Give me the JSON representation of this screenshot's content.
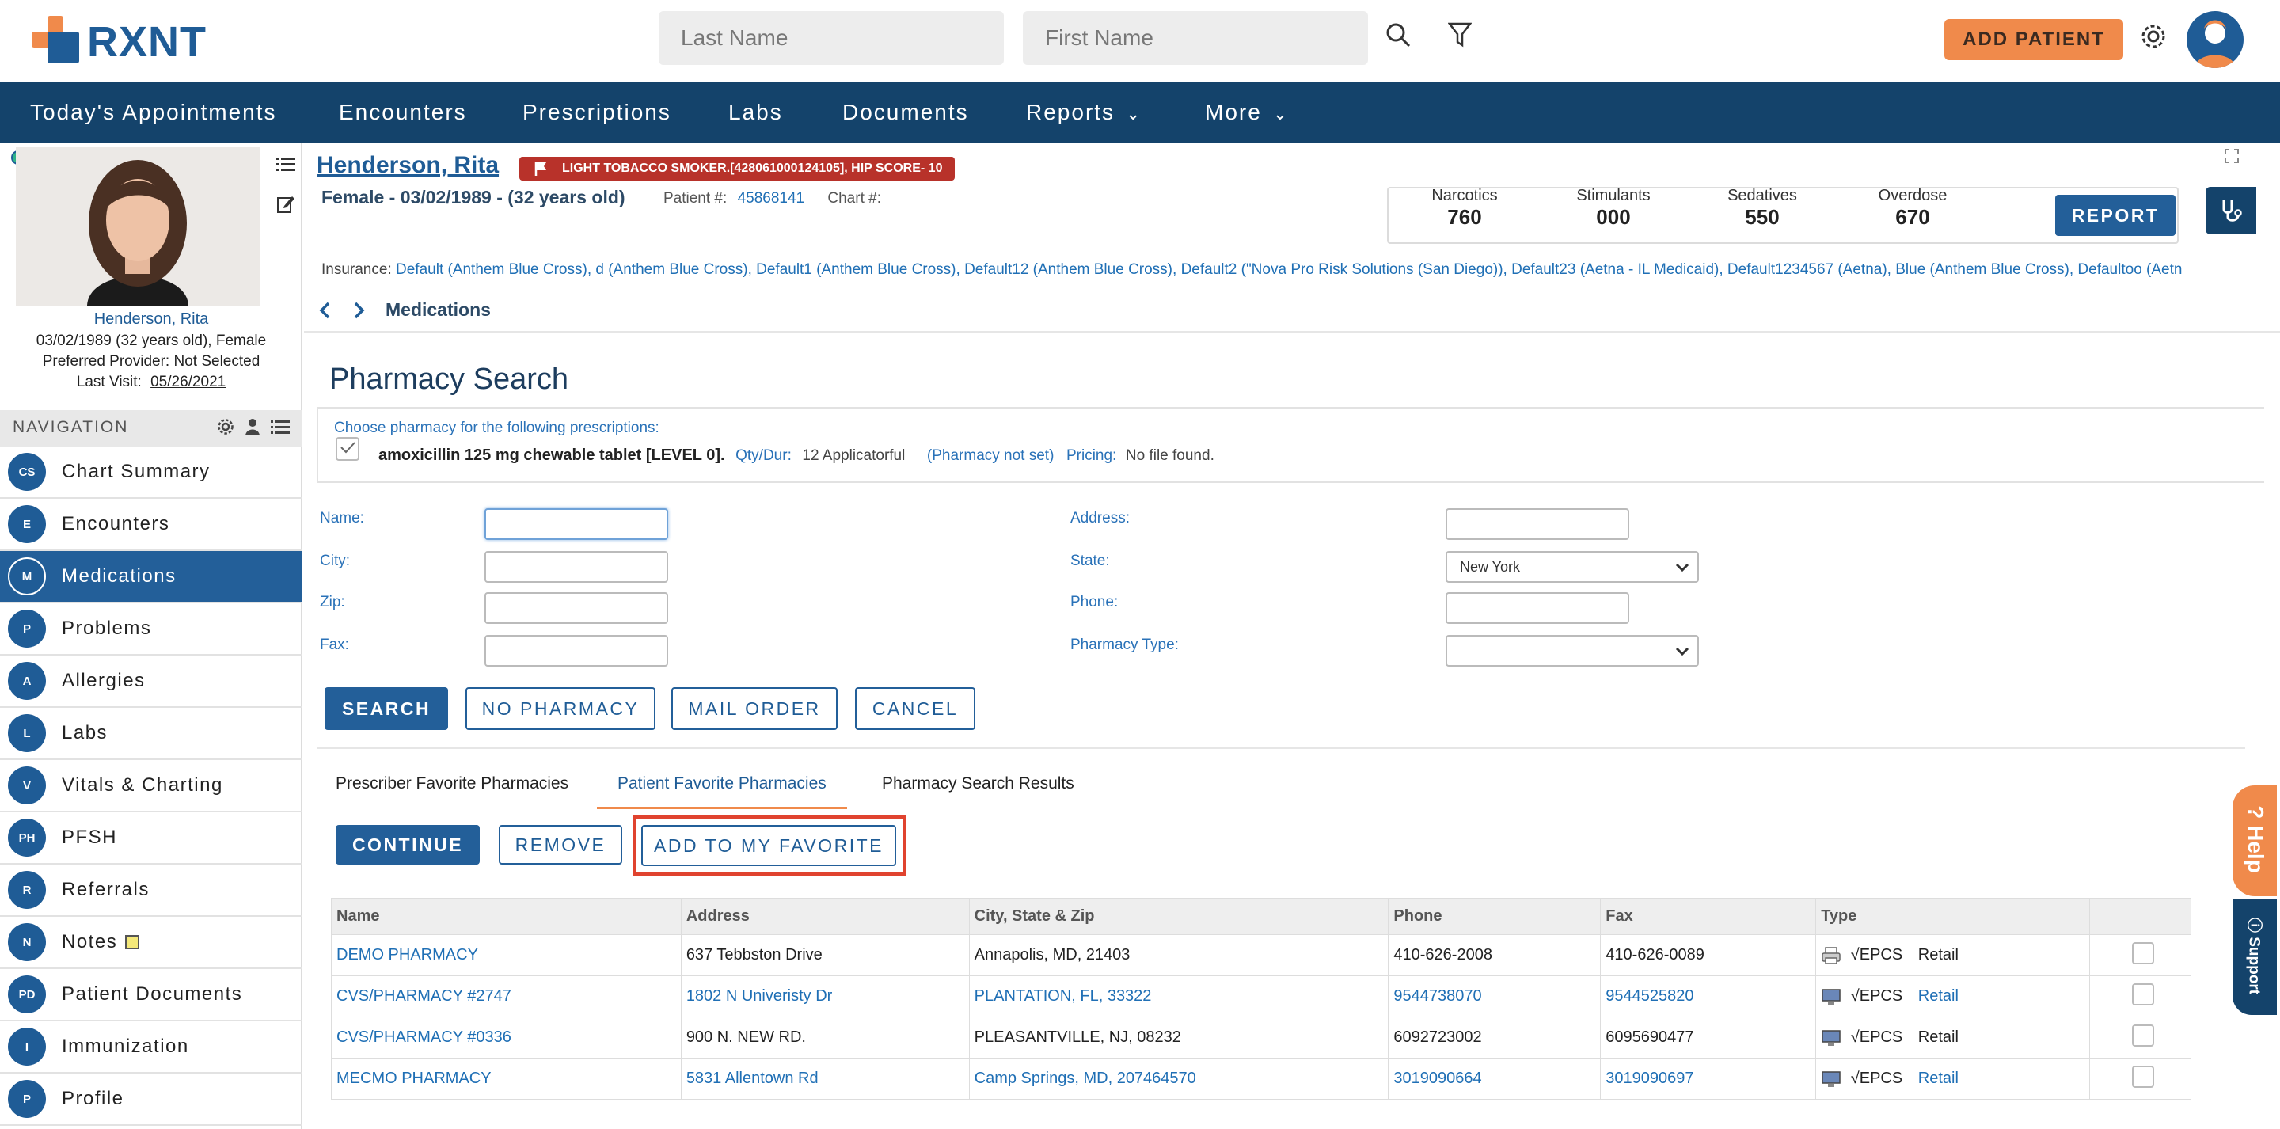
{
  "app": {
    "logo_text": "RXNT",
    "search": {
      "last_name_placeholder": "Last Name",
      "first_name_placeholder": "First Name"
    },
    "add_patient_label": "ADD PATIENT"
  },
  "nav": {
    "items": [
      {
        "label": "Today's Appointments"
      },
      {
        "label": "Encounters"
      },
      {
        "label": "Prescriptions"
      },
      {
        "label": "Labs"
      },
      {
        "label": "Documents"
      },
      {
        "label": "Reports"
      },
      {
        "label": "More"
      }
    ]
  },
  "patient_card": {
    "name": "Henderson, Rita",
    "dob_line": "03/02/1989 (32 years old), Female",
    "provider_line": "Preferred Provider: Not Selected",
    "last_visit_label": "Last Visit:",
    "last_visit_date": "05/26/2021"
  },
  "sidebar": {
    "nav_title": "NAVIGATION",
    "items": [
      {
        "badge": "CS",
        "label": "Chart Summary"
      },
      {
        "badge": "E",
        "label": "Encounters"
      },
      {
        "badge": "M",
        "label": "Medications"
      },
      {
        "badge": "P",
        "label": "Problems"
      },
      {
        "badge": "A",
        "label": "Allergies"
      },
      {
        "badge": "L",
        "label": "Labs"
      },
      {
        "badge": "V",
        "label": "Vitals & Charting"
      },
      {
        "badge": "PH",
        "label": "PFSH"
      },
      {
        "badge": "R",
        "label": "Referrals"
      },
      {
        "badge": "N",
        "label": "Notes"
      },
      {
        "badge": "PD",
        "label": "Patient Documents"
      },
      {
        "badge": "I",
        "label": "Immunization"
      },
      {
        "badge": "P",
        "label": "Profile"
      }
    ]
  },
  "header": {
    "patient_name": "Henderson, Rita",
    "flag_text": "LIGHT TOBACCO SMOKER.[428061000124105], HIP SCORE- 10",
    "demographics": "Female - 03/02/1989 - (32 years old)",
    "patient_num_label": "Patient #:",
    "patient_num": "45868141",
    "chart_label": "Chart #:",
    "scores": [
      {
        "label": "Narcotics",
        "value": "760"
      },
      {
        "label": "Stimulants",
        "value": "000"
      },
      {
        "label": "Sedatives",
        "value": "550"
      },
      {
        "label": "Overdose",
        "value": "670"
      }
    ],
    "report_label": "REPORT",
    "insurance_label": "Insurance:",
    "insurance_text": "Default (Anthem Blue Cross), d (Anthem Blue Cross), Default1 (Anthem Blue Cross), Default12 (Anthem Blue Cross), Default2 (\"Nova Pro Risk Solutions (San Diego)), Default23 (Aetna - IL Medicaid), Default1234567 (Aetna), Blue (Anthem Blue Cross), Defaultoo (Aetn"
  },
  "breadcrumb": {
    "current": "Medications"
  },
  "pharmacy": {
    "title": "Pharmacy Search",
    "choose_text": "Choose pharmacy for the following prescriptions:",
    "rx_name": "amoxicillin 125 mg chewable tablet [LEVEL 0].",
    "qty_label": "Qty/Dur:",
    "qty_value": "12 Applicatorful",
    "pharmacy_not_set": "(Pharmacy not set)",
    "pricing_label": "Pricing:",
    "pricing_value": "No file found.",
    "form": {
      "name_label": "Name:",
      "city_label": "City:",
      "zip_label": "Zip:",
      "fax_label": "Fax:",
      "address_label": "Address:",
      "state_label": "State:",
      "state_value": "New York",
      "phone_label": "Phone:",
      "type_label": "Pharmacy Type:"
    },
    "buttons": {
      "search": "SEARCH",
      "no_pharmacy": "NO PHARMACY",
      "mail_order": "MAIL ORDER",
      "cancel": "CANCEL"
    },
    "tabs": [
      {
        "label": "Prescriber Favorite Pharmacies"
      },
      {
        "label": "Patient Favorite Pharmacies"
      },
      {
        "label": "Pharmacy Search Results"
      }
    ],
    "actions": {
      "continue": "CONTINUE",
      "remove": "REMOVE",
      "add_favorite": "ADD TO MY FAVORITE"
    },
    "table": {
      "headers": [
        "Name",
        "Address",
        "City, State & Zip",
        "Phone",
        "Fax",
        "Type"
      ],
      "rows": [
        {
          "name": "DEMO PHARMACY",
          "address": "637 Tebbston Drive",
          "city": "Annapolis, MD, 21403",
          "phone": "410-626-2008",
          "fax": "410-626-0089",
          "epcs": "√EPCS",
          "type": "Retail",
          "icon": "printer-icon"
        },
        {
          "name": "CVS/PHARMACY #2747",
          "address": "1802 N Univeristy Dr",
          "city": "PLANTATION, FL, 33322",
          "phone": "9544738070",
          "fax": "9544525820",
          "epcs": "√EPCS",
          "type": "Retail",
          "icon": "computer-icon"
        },
        {
          "name": "CVS/PHARMACY #0336",
          "address": "900 N. NEW RD.",
          "city": "PLEASANTVILLE, NJ, 08232",
          "phone": "6092723002",
          "fax": "6095690477",
          "epcs": "√EPCS",
          "type": "Retail",
          "icon": "computer-icon"
        },
        {
          "name": "MECMO PHARMACY",
          "address": "5831 Allentown Rd",
          "city": "Camp Springs, MD, 207464570",
          "phone": "3019090664",
          "fax": "3019090697",
          "epcs": "√EPCS",
          "type": "Retail",
          "icon": "computer-icon"
        }
      ]
    }
  },
  "help": {
    "help_label": "Help",
    "support_label": "Support"
  },
  "colors": {
    "brand": "#1f5c96",
    "nav_bg": "#14436b",
    "accent": "#f08a4b",
    "flag": "#b8322a",
    "highlight": "#e0432f"
  }
}
